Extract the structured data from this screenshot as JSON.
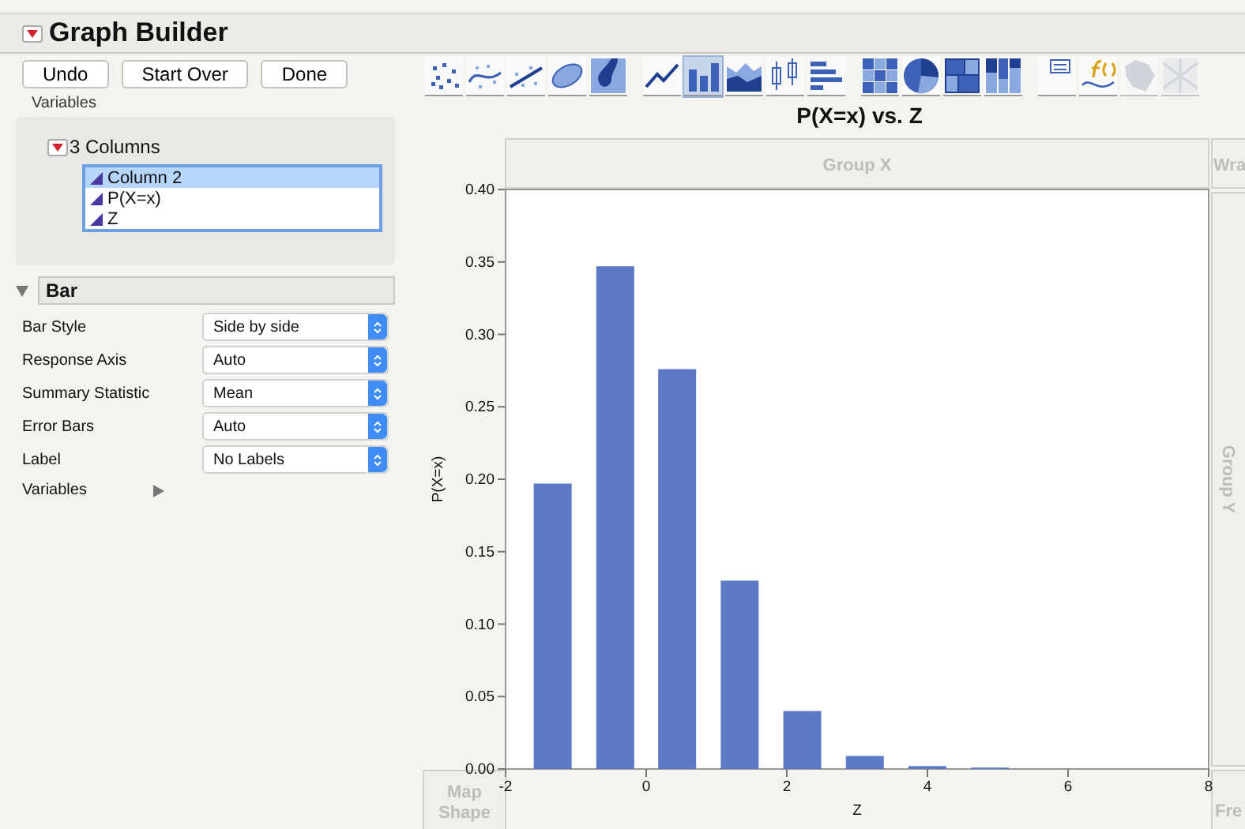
{
  "window": {
    "title": "Graph Builder"
  },
  "buttons": [
    "Undo",
    "Start Over",
    "Done"
  ],
  "variables": {
    "label": "Variables",
    "group": "3 Columns",
    "columns": [
      {
        "name": "Column 2",
        "selected": true
      },
      {
        "name": "P(X=x)",
        "selected": false
      },
      {
        "name": "Z",
        "selected": false
      }
    ]
  },
  "bar_section": {
    "title": "Bar",
    "expanded": true,
    "options": [
      {
        "label": "Bar Style",
        "value": "Side by side"
      },
      {
        "label": "Response Axis",
        "value": "Auto"
      },
      {
        "label": "Summary Statistic",
        "value": "Mean"
      },
      {
        "label": "Error Bars",
        "value": "Auto"
      },
      {
        "label": "Label",
        "value": "No Labels"
      }
    ],
    "variables_label": "Variables"
  },
  "toolbar": [
    [
      {
        "kind": "points",
        "selected": false,
        "disabled": false
      },
      {
        "kind": "smoother",
        "selected": false,
        "disabled": false
      },
      {
        "kind": "fit",
        "selected": false,
        "disabled": false
      },
      {
        "kind": "ellipse",
        "selected": false,
        "disabled": false
      },
      {
        "kind": "contour",
        "selected": false,
        "disabled": false
      }
    ],
    [
      {
        "kind": "line",
        "selected": false,
        "disabled": false
      },
      {
        "kind": "bar",
        "selected": true,
        "disabled": false
      },
      {
        "kind": "area",
        "selected": false,
        "disabled": false
      },
      {
        "kind": "box",
        "selected": false,
        "disabled": false
      },
      {
        "kind": "histogram",
        "selected": false,
        "disabled": false
      }
    ],
    [
      {
        "kind": "heatmap",
        "selected": false,
        "disabled": false
      },
      {
        "kind": "pie",
        "selected": false,
        "disabled": false
      },
      {
        "kind": "treemap",
        "selected": false,
        "disabled": false
      },
      {
        "kind": "mosaic",
        "selected": false,
        "disabled": false
      }
    ],
    [
      {
        "kind": "caption",
        "selected": false,
        "disabled": false
      },
      {
        "kind": "formula",
        "selected": false,
        "disabled": false
      },
      {
        "kind": "mapshape",
        "selected": false,
        "disabled": true
      },
      {
        "kind": "streetmap",
        "selected": false,
        "disabled": true
      }
    ]
  ],
  "graph": {
    "zones": {
      "group_x": "Group X",
      "wrap": "Wra",
      "group_y": "Group Y",
      "map_shape": [
        "Map",
        "Shape"
      ],
      "freq": "Fre"
    },
    "chart_data": {
      "type": "bar",
      "title": "P(X=x) vs. Z",
      "xlabel": "Z",
      "ylabel": "P(X=x)",
      "x": [
        -1.33,
        -0.44,
        0.44,
        1.33,
        2.22,
        3.11,
        4.0,
        4.89
      ],
      "values": [
        0.197,
        0.347,
        0.276,
        0.13,
        0.04,
        0.009,
        0.002,
        0.001
      ],
      "xlim": [
        -2,
        8
      ],
      "ylim": [
        0,
        0.4
      ],
      "xticks": [
        -2,
        0,
        2,
        4,
        6,
        8
      ],
      "yticks": [
        {
          "value": 0,
          "label": "0.00"
        },
        {
          "value": 0.05,
          "label": "0.05"
        },
        {
          "value": 0.1,
          "label": "0.10"
        },
        {
          "value": 0.15,
          "label": "0.15"
        },
        {
          "value": 0.2,
          "label": "0.20"
        },
        {
          "value": 0.25,
          "label": "0.25"
        },
        {
          "value": 0.3,
          "label": "0.30"
        },
        {
          "value": 0.35,
          "label": "0.35"
        },
        {
          "value": 0.4,
          "label": "0.40"
        }
      ]
    }
  }
}
